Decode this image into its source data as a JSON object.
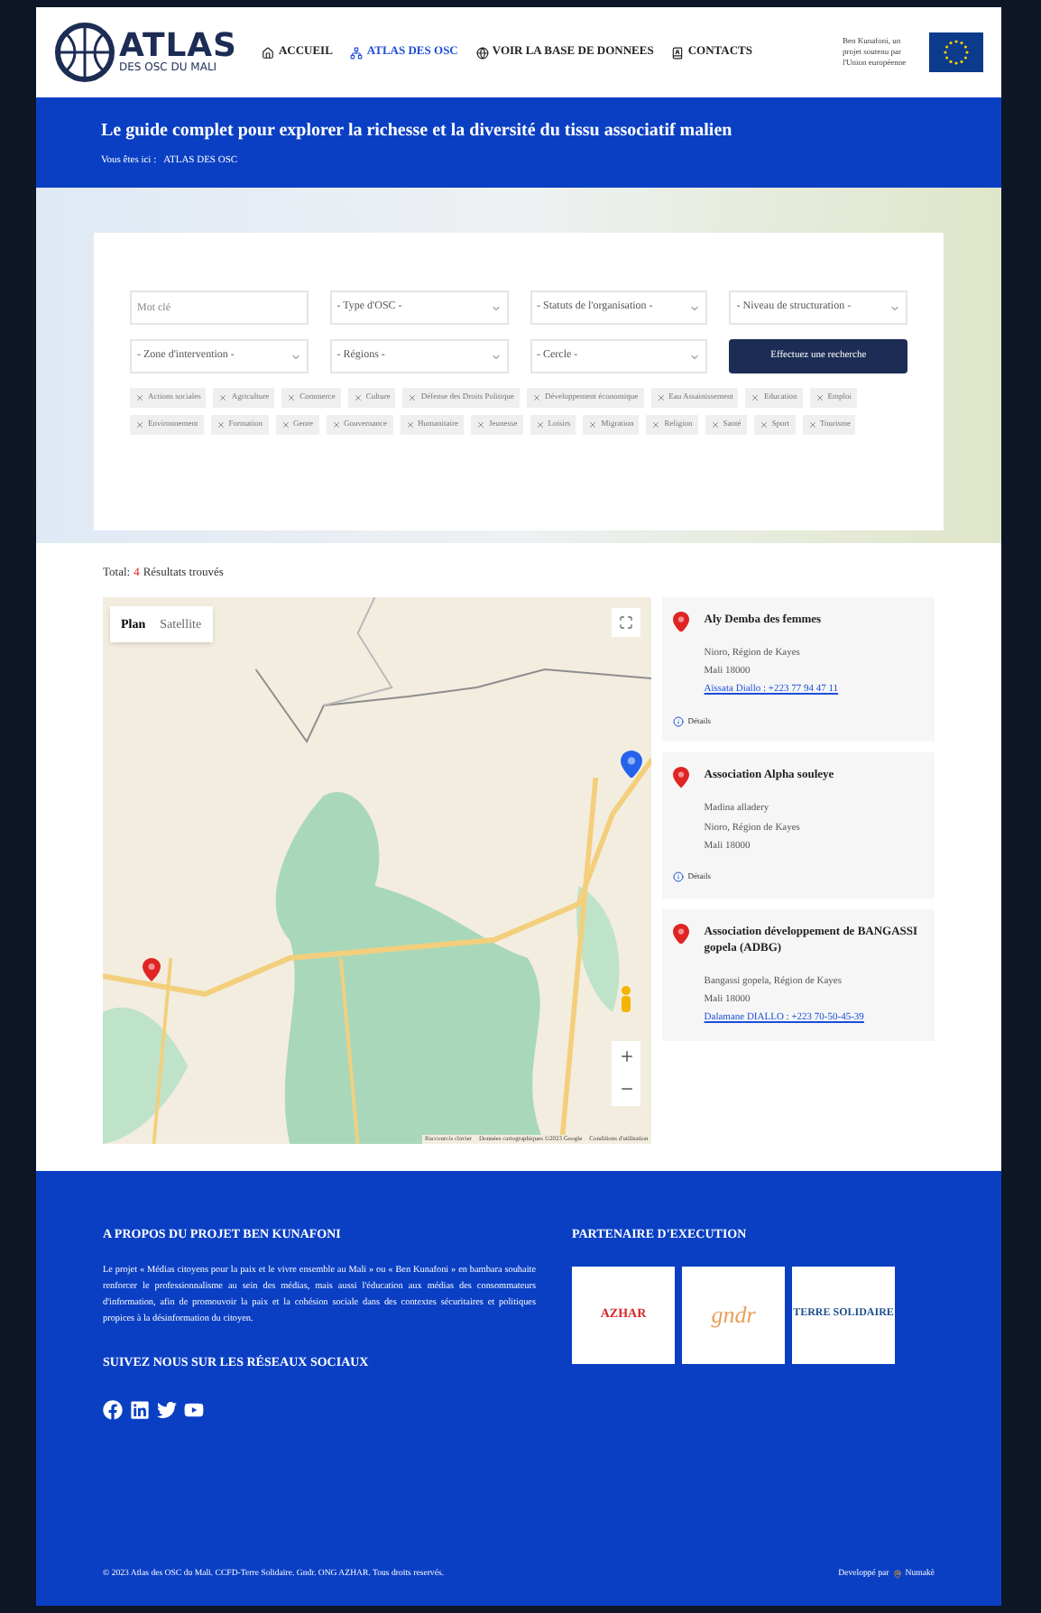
{
  "header": {
    "logo": {
      "title": "ATLAS",
      "subtitle": "DES OSC DU MALI"
    },
    "nav": [
      {
        "label": "ACCUEIL",
        "selected": false
      },
      {
        "label": "ATLAS DES OSC",
        "selected": true
      },
      {
        "label": "VOIR LA BASE DE DONNEES",
        "selected": false
      },
      {
        "label": "CONTACTS",
        "selected": false
      }
    ],
    "eu_note": "Ben Kunafoni, un projet soutenu par l'Union européenne"
  },
  "banner": {
    "title": "Le guide complet pour explorer la richesse et la diversité du tissu associatif malien",
    "breadcrumb_label": "Vous êtes ici :",
    "breadcrumb": "ATLAS DES OSC"
  },
  "search": {
    "keyword": {
      "placeholder": "Mot clé"
    },
    "selects": [
      "- Type d'OSC -",
      "- Statuts de l'organisation -",
      "- Niveau de structuration -",
      "- Zone d'intervention -",
      "- Régions -",
      "- Cercle -"
    ],
    "button": "Effectuez une recherche",
    "tags": [
      "Actions sociales",
      "Agriculture",
      "Commerce",
      "Culture",
      "Défense des Droits Politique",
      "Développement économique",
      "Eau Assainissement",
      "Education",
      "Emploi",
      "Environnement",
      "Formation",
      "Genre",
      "Gouvernance",
      "Humanitaire",
      "Jeunesse",
      "Loisirs",
      "Migration",
      "Religion",
      "Santé",
      "Sport",
      "Tourisme"
    ]
  },
  "results": {
    "label": "Total:",
    "count": "4",
    "suffix": "Résultats trouvés"
  },
  "map": {
    "view_tabs": [
      {
        "label": "Plan",
        "selected": true
      },
      {
        "label": "Satellite",
        "selected": false
      }
    ],
    "attribution": [
      "Raccourcis clavier",
      "Données cartographiques ©2023 Google",
      "Conditions d'utilisation"
    ]
  },
  "listings": [
    {
      "name": "Aly Demba des femmes",
      "lines": [
        "Nioro, Région de Kayes",
        "Mali 18000"
      ],
      "contact": "Aïssata Diallo : +223 77 94 47 11",
      "details": "Détails"
    },
    {
      "name": "Association Alpha souleye",
      "lines": [
        "Madina alladery",
        "Nioro, Région de Kayes",
        "Mali 18000"
      ],
      "details": "Détails"
    },
    {
      "name": "Association développement de BANGASSI gopela (ADBG)",
      "lines": [
        "Bangassi gopela, Région de Kayes",
        "Mali 18000"
      ],
      "contact": "Dalamane DIALLO : +223 70-50-45-39"
    }
  ],
  "footer": {
    "about_title": "A PROPOS DU PROJET BEN KUNAFONI",
    "about_text": "Le projet « Médias citoyens pour la paix et le vivre ensemble au Mali » ou « Ben Kunafoni » en bambara souhaite renforcer le professionnalisme au sein des médias, mais aussi l'éducation aux médias des consommateurs d'information, afin de promouvoir la paix et la cohésion sociale dans des contextes sécuritaires et politiques propices à la désinformation du citoyen.",
    "social_title": "SUIVEZ NOUS SUR LES RÉSEAUX SOCIAUX",
    "partners_title": "PARTENAIRE D'EXECUTION",
    "partners": [
      {
        "kind": "azhar",
        "name": "AZHAR"
      },
      {
        "kind": "gndr",
        "name": "gndr"
      },
      {
        "kind": "terre",
        "name": "TERRE SOLIDAIRE"
      }
    ],
    "copyright": "© 2023 Atlas des OSC du Mali. CCFD-Terre Solidaire. Gndr. ONG AZHAR. Tous droits reservés.",
    "credit_label": "Developpé par",
    "credit_name": "Numakè"
  }
}
